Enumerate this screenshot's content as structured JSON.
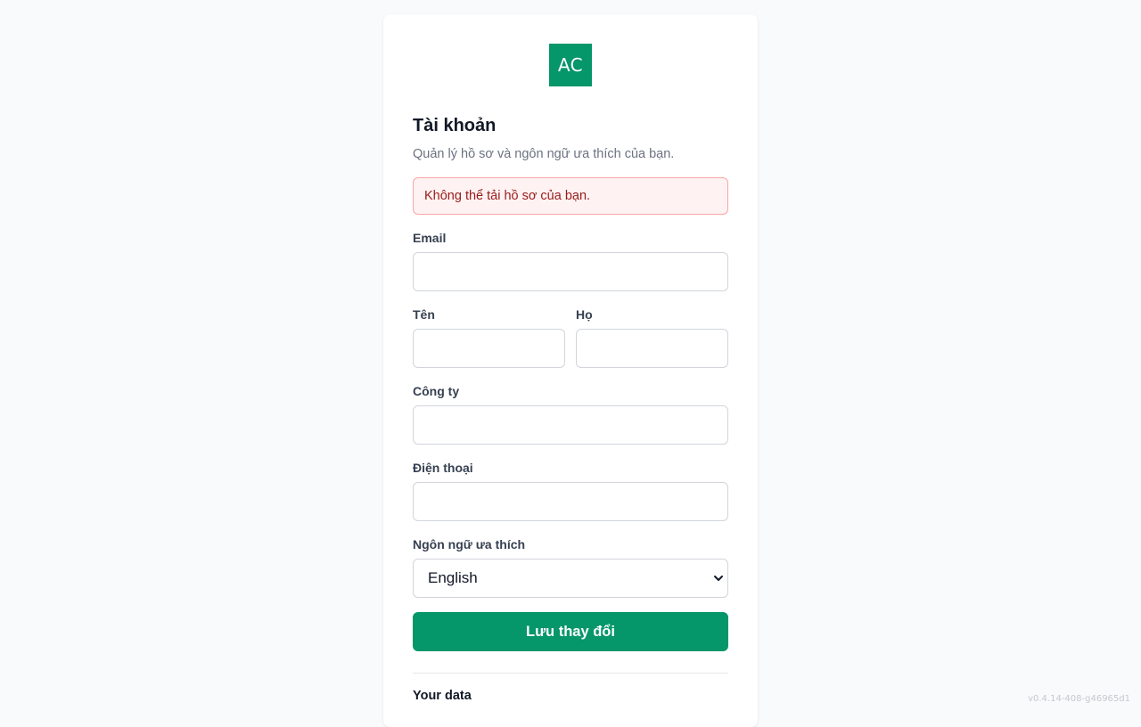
{
  "brand": {
    "logo_text": "AC",
    "accent_color": "#059669"
  },
  "header": {
    "title": "Tài khoản",
    "subtitle": "Quản lý hồ sơ và ngôn ngữ ưa thích của bạn."
  },
  "alert": {
    "message": "Không thể tải hồ sơ của bạn.",
    "type": "error"
  },
  "form": {
    "email": {
      "label": "Email",
      "value": "",
      "placeholder": ""
    },
    "first_name": {
      "label": "Tên",
      "value": "",
      "placeholder": ""
    },
    "last_name": {
      "label": "Họ",
      "value": "",
      "placeholder": ""
    },
    "company": {
      "label": "Công ty",
      "value": "",
      "placeholder": ""
    },
    "phone": {
      "label": "Điện thoại",
      "value": "",
      "placeholder": ""
    },
    "language": {
      "label": "Ngôn ngữ ưa thích",
      "selected": "English"
    },
    "save_label": "Lưu thay đổi"
  },
  "data_section": {
    "title": "Your data"
  },
  "footer": {
    "version": "v0.4.14-408-g46965d1"
  }
}
